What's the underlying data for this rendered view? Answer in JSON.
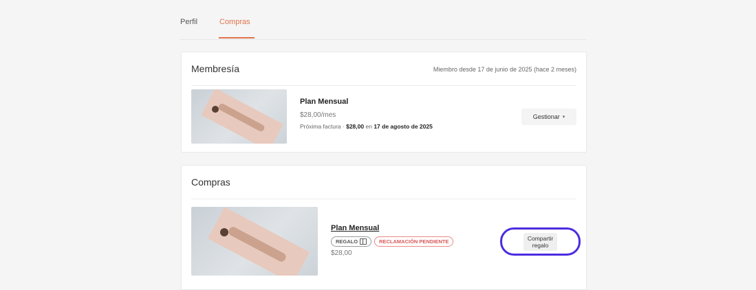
{
  "tabs": {
    "perfil": "Perfil",
    "compras": "Compras",
    "active_color": "#e0734b"
  },
  "membership": {
    "title": "Membresía",
    "member_since": "Miembro desde 17 de junio de 2025 (hace 2 meses)",
    "plan_name": "Plan Mensual",
    "price": "$28,00/mes",
    "next_invoice_label": "Próxima factura",
    "next_invoice_amount": "$28,00",
    "next_invoice_on": "en",
    "next_invoice_date": "17 de agosto de 2025",
    "manage_label": "Gestionar"
  },
  "purchases": {
    "title": "Compras",
    "plan_name": "Plan Mensual",
    "badge_gift": "REGALO",
    "badge_pending": "RECLAMACIÓN PENDIENTE",
    "price": "$28,00",
    "share_line1": "Compartir",
    "share_line2": "regalo",
    "highlight_color": "#4b2be0"
  },
  "icons": {
    "chevron": "chevron-down-icon",
    "gift": "gift-icon"
  }
}
